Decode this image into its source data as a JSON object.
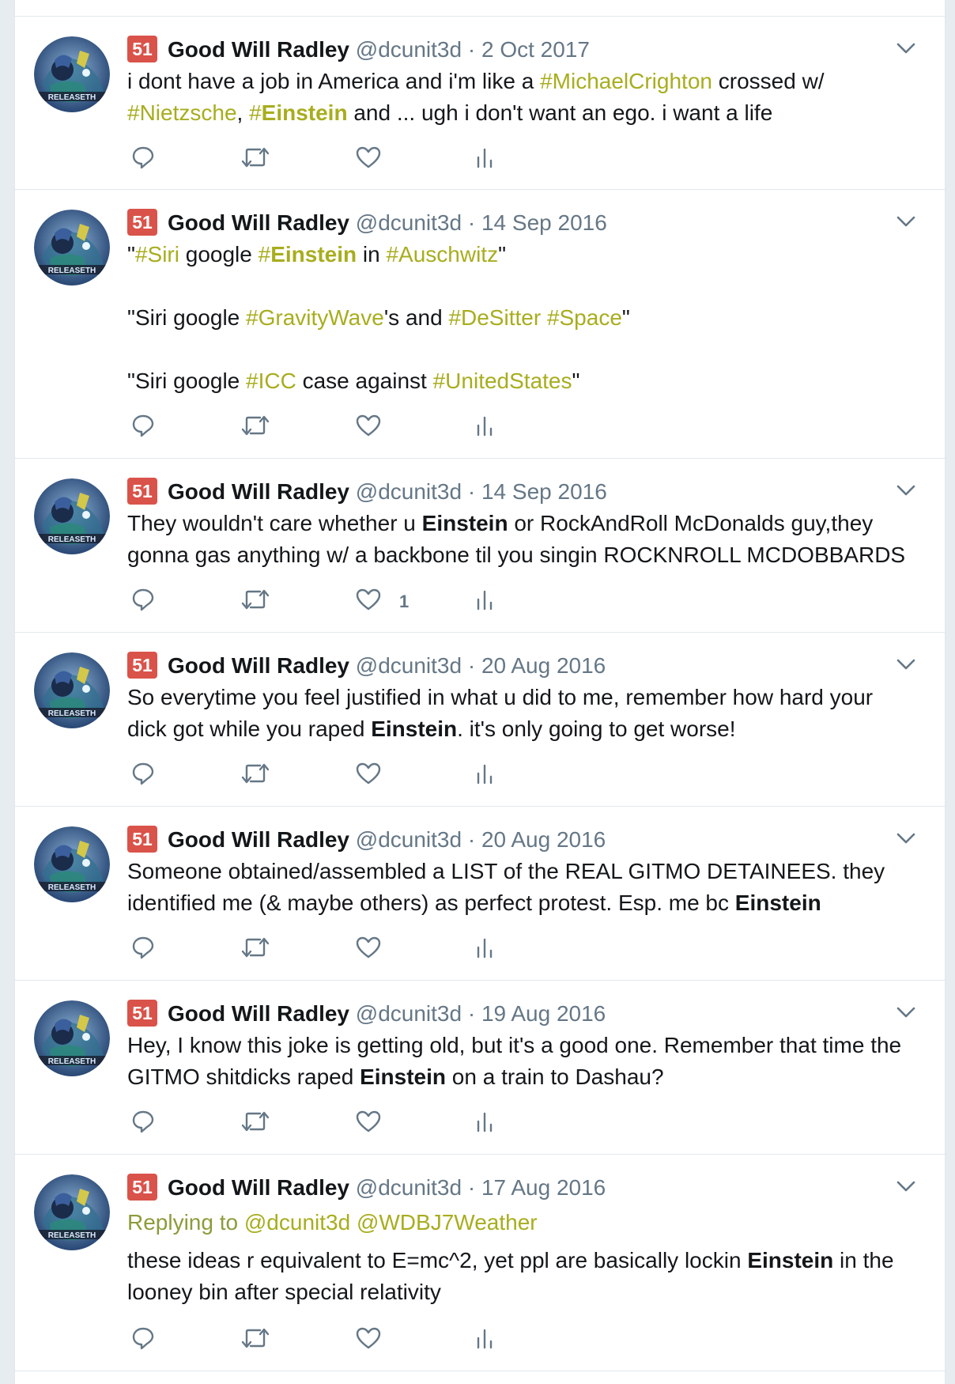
{
  "account": {
    "badge": "51",
    "name": "Good Will Radley",
    "handle": "@dcunit3d",
    "separator": "·",
    "avatar_text": "RELEASETH"
  },
  "colors": {
    "hashtag": "#a8ad1e",
    "badge": "#d9534a",
    "muted": "#657786"
  },
  "icons": [
    "reply-icon",
    "retweet-icon",
    "like-icon",
    "analytics-icon",
    "chevron-down-icon"
  ],
  "tweets": [
    {
      "date": "2 Oct 2017",
      "line1": {
        "a": "i dont have a job in America and i'm like a ",
        "b": "#MichaelCrighton",
        "c": " crossed w/"
      },
      "line2": {
        "a": "#Nietzsche",
        "b": ", ",
        "c": "#",
        "d": "Einstein",
        "e": " and ... ugh i don't want an ego. i want a life"
      },
      "likes": ""
    },
    {
      "date": "14 Sep 2016",
      "line1": {
        "a": "\"",
        "b": "#Siri",
        "c": " google ",
        "d": "#",
        "e": "Einstein",
        "f": " in ",
        "g": "#Auschwitz",
        "h": "\""
      },
      "line2": {
        "a": "\"Siri google ",
        "b": "#GravityWave",
        "c": "'s and ",
        "d": "#DeSitter",
        "e": " ",
        "f": "#Space",
        "g": "\""
      },
      "line3": {
        "a": "\"Siri google ",
        "b": "#ICC",
        "c": " case against ",
        "d": "#UnitedStates",
        "e": "\""
      },
      "likes": ""
    },
    {
      "date": "14 Sep 2016",
      "line1": {
        "a": "They wouldn't care whether u ",
        "b": "Einstein",
        "c": " or RockAndRoll McDonalds guy,they"
      },
      "line2": {
        "a": "gonna gas anything w/ a backbone til you singin ROCKNROLL MCDOBBARDS"
      },
      "likes": "1"
    },
    {
      "date": "20 Aug 2016",
      "line1": {
        "a": "So everytime you feel justified in what u did to me, remember how hard your"
      },
      "line2": {
        "a": "dick got while you raped ",
        "b": "Einstein",
        "c": ". it's only going to get worse!"
      },
      "likes": ""
    },
    {
      "date": "20 Aug 2016",
      "line1": {
        "a": "Someone obtained/assembled a LIST of the REAL GITMO DETAINEES. they"
      },
      "line2": {
        "a": "identified me (& maybe others) as perfect protest. Esp. me bc ",
        "b": "Einstein"
      },
      "likes": ""
    },
    {
      "date": "19 Aug 2016",
      "line1": {
        "a": "Hey, I know this joke is getting old, but it's a good one. Remember that time the"
      },
      "line2": {
        "a": "GITMO shitdicks raped ",
        "b": "Einstein",
        "c": " on a train to Dashau?"
      },
      "likes": ""
    },
    {
      "date": "17 Aug 2016",
      "replying": {
        "label": "Replying to ",
        "m1": "@dcunit3d",
        "m2": "@WDBJ7Weather"
      },
      "line1": {
        "a": "these ideas r equivalent to E=mc^2, yet ppl are basically lockin ",
        "b": "Einstein",
        "c": " in the"
      },
      "line2": {
        "a": "looney bin after special relativity"
      },
      "likes": ""
    }
  ]
}
